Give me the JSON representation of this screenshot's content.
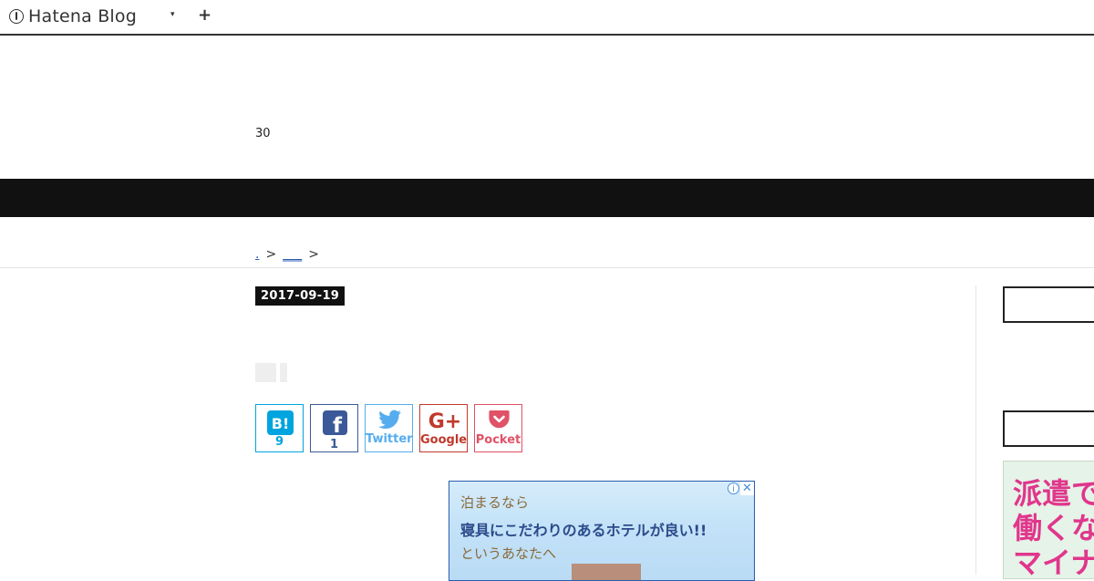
{
  "header": {
    "logo_text": "Hatena Blog",
    "caret": "▾",
    "plus": "+"
  },
  "blog": {
    "description": "30"
  },
  "breadcrumb": {
    "first": ".",
    "sep1": ">",
    "second": "___",
    "sep2": ">"
  },
  "entry": {
    "date": "2017-09-19"
  },
  "share": {
    "hatena": {
      "icon": "B!",
      "count": "9"
    },
    "facebook": {
      "icon": "f",
      "count": "1"
    },
    "twitter": {
      "label": "Twitter"
    },
    "google": {
      "icon": "G+",
      "label": "Google"
    },
    "pocket": {
      "label": "Pocket"
    }
  },
  "ad": {
    "line1": "泊まるなら",
    "line2": "寝具にこだわりのあるホテルが良い!!",
    "line3": "というあなたへ",
    "info": "i",
    "close": "✕"
  },
  "sidebar_ad": {
    "line1": "派遣で",
    "line2": "働くな",
    "line3": "マイナ"
  },
  "colors": {
    "hatena": "#00a4de",
    "facebook": "#3b5998",
    "twitter": "#55acee",
    "google": "#c0392b",
    "pocket": "#e05267",
    "ad_pink": "#e0368c"
  }
}
